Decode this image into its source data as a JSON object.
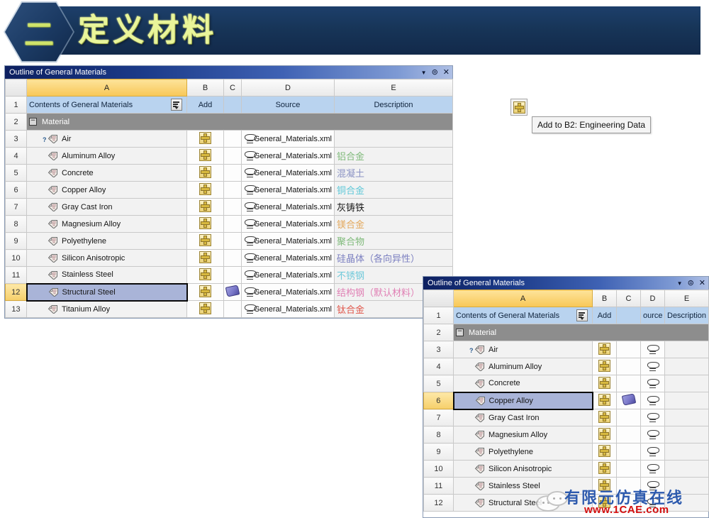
{
  "banner": {
    "badge_number": "二",
    "title": "定义材料",
    "bar_color": "#173558",
    "title_color": "#e9f59a"
  },
  "tooltip": {
    "button_icon": "add-icon",
    "text": "Add to B2: Engineering Data"
  },
  "watermark": {
    "chinese": "有限元仿真在线",
    "url": "www.1CAE.com",
    "faint": "1CAE.com"
  },
  "window_main": {
    "title": "Outline of General Materials",
    "controls": [
      "chevron-down-icon",
      "pin-icon",
      "close-icon"
    ],
    "column_letters": [
      "A",
      "B",
      "C",
      "D",
      "E"
    ],
    "header_row": {
      "number": "1",
      "a": "Contents of General Materials",
      "b": "Add",
      "d": "Source",
      "e": "Description"
    },
    "group_row": {
      "number": "2",
      "label": "Material"
    },
    "rows": [
      {
        "number": "3",
        "name": "Air",
        "unknown": true,
        "add": true,
        "book": false,
        "source": "General_Materials.xml",
        "desc": "",
        "desc_color": "#333333"
      },
      {
        "number": "4",
        "name": "Aluminum Alloy",
        "unknown": false,
        "add": true,
        "book": false,
        "source": "General_Materials.xml",
        "desc": "铝合金",
        "desc_color": "#7fba7a"
      },
      {
        "number": "5",
        "name": "Concrete",
        "unknown": false,
        "add": true,
        "book": false,
        "source": "General_Materials.xml",
        "desc": "混凝土",
        "desc_color": "#8b93c4"
      },
      {
        "number": "6",
        "name": "Copper Alloy",
        "unknown": false,
        "add": true,
        "book": false,
        "source": "General_Materials.xml",
        "desc": "铜合金",
        "desc_color": "#5fc8d8"
      },
      {
        "number": "7",
        "name": "Gray Cast Iron",
        "unknown": false,
        "add": true,
        "book": false,
        "source": "General_Materials.xml",
        "desc": "灰铸铁",
        "desc_color": "#1a1a1a"
      },
      {
        "number": "8",
        "name": "Magnesium Alloy",
        "unknown": false,
        "add": true,
        "book": false,
        "source": "General_Materials.xml",
        "desc": "镁合金",
        "desc_color": "#e3a85c"
      },
      {
        "number": "9",
        "name": "Polyethylene",
        "unknown": false,
        "add": true,
        "book": false,
        "source": "General_Materials.xml",
        "desc": "聚合物",
        "desc_color": "#7fba7a"
      },
      {
        "number": "10",
        "name": "Silicon Anisotropic",
        "unknown": false,
        "add": true,
        "book": false,
        "source": "General_Materials.xml",
        "desc": "硅晶体（各向异性）",
        "desc_color": "#7b7fc0"
      },
      {
        "number": "11",
        "name": "Stainless Steel",
        "unknown": false,
        "add": true,
        "book": false,
        "source": "General_Materials.xml",
        "desc": "不锈钢",
        "desc_color": "#6fc9da"
      },
      {
        "number": "12",
        "name": "Structural Steel",
        "unknown": false,
        "add": true,
        "book": true,
        "source": "General_Materials.xml",
        "desc": "结构钢（默认材料）",
        "desc_color": "#e07fb4",
        "selected": true
      },
      {
        "number": "13",
        "name": "Titanium Alloy",
        "unknown": false,
        "add": true,
        "book": false,
        "source": "General_Materials.xml",
        "desc": "钛合金",
        "desc_color": "#e0564a"
      }
    ]
  },
  "window_second": {
    "title": "Outline of General Materials",
    "controls": [
      "chevron-down-icon",
      "pin-icon",
      "close-icon"
    ],
    "column_letters": [
      "A",
      "B",
      "C",
      "D",
      "E"
    ],
    "header_row": {
      "number": "1",
      "a": "Contents of General Materials",
      "b": "Add",
      "d": "ource",
      "e": "Description"
    },
    "group_row": {
      "number": "2",
      "label": "Material"
    },
    "rows": [
      {
        "number": "3",
        "name": "Air",
        "unknown": true,
        "add": true,
        "book": false,
        "link": true
      },
      {
        "number": "4",
        "name": "Aluminum Alloy",
        "unknown": false,
        "add": true,
        "book": false,
        "link": true
      },
      {
        "number": "5",
        "name": "Concrete",
        "unknown": false,
        "add": true,
        "book": false,
        "link": true
      },
      {
        "number": "6",
        "name": "Copper Alloy",
        "unknown": false,
        "add": true,
        "book": true,
        "link": true,
        "selected": true
      },
      {
        "number": "7",
        "name": "Gray Cast Iron",
        "unknown": false,
        "add": true,
        "book": false,
        "link": true
      },
      {
        "number": "8",
        "name": "Magnesium Alloy",
        "unknown": false,
        "add": true,
        "book": false,
        "link": true
      },
      {
        "number": "9",
        "name": "Polyethylene",
        "unknown": false,
        "add": true,
        "book": false,
        "link": true
      },
      {
        "number": "10",
        "name": "Silicon Anisotropic",
        "unknown": false,
        "add": true,
        "book": false,
        "link": true
      },
      {
        "number": "11",
        "name": "Stainless Steel",
        "unknown": false,
        "add": true,
        "book": false,
        "link": true
      },
      {
        "number": "12",
        "name": "Structural Steel",
        "unknown": false,
        "add": true,
        "book": false,
        "link": true
      }
    ]
  }
}
